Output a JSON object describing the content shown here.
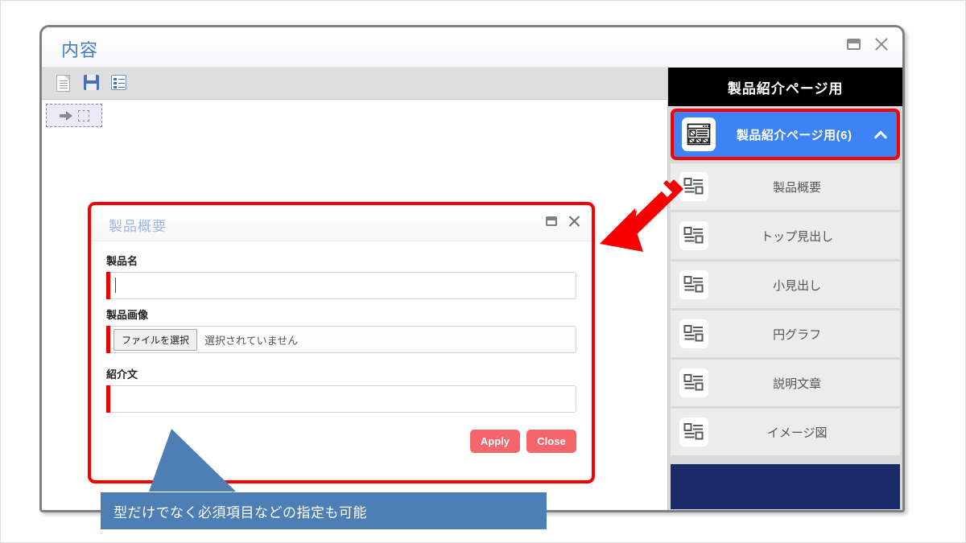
{
  "outer_window": {
    "title": "内容",
    "controls": {
      "restore": "restore-icon",
      "close": "close-icon"
    },
    "toolbar": [
      {
        "name": "new-document-icon",
        "label": "新規"
      },
      {
        "name": "save-icon",
        "label": "保存"
      },
      {
        "name": "list-icon",
        "label": "一覧"
      }
    ],
    "dropzone": {
      "arrow": "arrow-right-icon",
      "placeholder": "drop-target-square"
    }
  },
  "inner_dialog": {
    "title": "製品概要",
    "controls": {
      "restore": "restore-icon",
      "close": "close-icon"
    },
    "fields": [
      {
        "label": "製品名",
        "type": "text",
        "value": "",
        "placeholder": "",
        "required": true
      },
      {
        "label": "製品画像",
        "type": "file",
        "button_label": "ファイルを選択",
        "status_text": "選択されていません",
        "required": true
      },
      {
        "label": "紹介文",
        "type": "text",
        "value": "",
        "placeholder": "",
        "required": true
      }
    ],
    "buttons": [
      {
        "label": "Apply",
        "name": "apply-button"
      },
      {
        "label": "Close",
        "name": "close-button"
      }
    ]
  },
  "sidebar": {
    "header_title": "製品紹介ページ用",
    "group": {
      "label": "製品紹介ページ用(6)",
      "count": 6,
      "expanded": true,
      "chevron": "chevron-up-icon",
      "icon": "page-layout-icon"
    },
    "items": [
      {
        "label": "製品概要",
        "icon": "block-layout-icon"
      },
      {
        "label": "トップ見出し",
        "icon": "block-layout-icon"
      },
      {
        "label": "小見出し",
        "icon": "block-layout-icon"
      },
      {
        "label": "円グラフ",
        "icon": "block-layout-icon"
      },
      {
        "label": "説明文章",
        "icon": "block-layout-icon"
      },
      {
        "label": "イメージ図",
        "icon": "block-layout-icon"
      }
    ]
  },
  "annotations": {
    "callout_text": "型だけでなく必須項目などの指定も可能",
    "arrow": "red-arrow-pointing-left"
  },
  "colors": {
    "accent_blue": "#3d83f5",
    "highlight_red": "#f90000",
    "button_red": "#f4666c",
    "callout_blue": "#4d7fb5",
    "sidebar_header": "#000000",
    "sidebar_footer": "#1b2a68",
    "title_blue": "#3e7fc9"
  }
}
